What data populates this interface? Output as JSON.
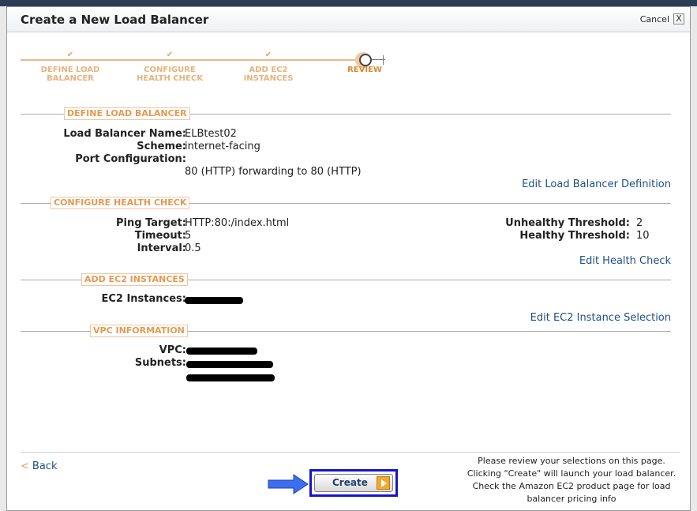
{
  "dialog": {
    "title": "Create a New Load Balancer",
    "cancel_label": "Cancel",
    "close_glyph": "X"
  },
  "wizard": {
    "check_glyph": "✔",
    "steps": [
      {
        "line1": "DEFINE LOAD",
        "line2": "BALANCER",
        "state": "done"
      },
      {
        "line1": "CONFIGURE",
        "line2": "HEALTH CHECK",
        "state": "done"
      },
      {
        "line1": "ADD EC2",
        "line2": "INSTANCES",
        "state": "done"
      },
      {
        "line1": "REVIEW",
        "line2": "",
        "state": "current"
      }
    ]
  },
  "define": {
    "tag": "DEFINE LOAD BALANCER",
    "name_label": "Load Balancer Name:",
    "name_value": "ELBtest02",
    "scheme_label": "Scheme:",
    "scheme_value": "internet-facing",
    "port_label": "Port Configuration:",
    "port_value": "80 (HTTP) forwarding to 80 (HTTP)",
    "edit_label": "Edit Load Balancer Definition"
  },
  "health": {
    "tag": "CONFIGURE HEALTH CHECK",
    "ping_label": "Ping Target:",
    "ping_value": "HTTP:80:/index.html",
    "timeout_label": "Timeout:",
    "timeout_value": "5",
    "interval_label": "Interval:",
    "interval_value": "0.5",
    "unhealthy_label": "Unhealthy Threshold:",
    "unhealthy_value": "2",
    "healthy_label": "Healthy Threshold:",
    "healthy_value": "10",
    "edit_label": "Edit Health Check"
  },
  "instances": {
    "tag": "ADD EC2 INSTANCES",
    "label": "EC2 Instances:",
    "edit_label": "Edit EC2 Instance Selection"
  },
  "vpc": {
    "tag": "VPC INFORMATION",
    "vpc_label": "VPC:",
    "subnets_label": "Subnets:"
  },
  "footer": {
    "back_glyph": "<",
    "back_label": "Back",
    "create_label": "Create",
    "note_line1": "Please review your selections on this page.",
    "note_line2": "Clicking \"Create\" will launch your load balancer.",
    "note_line3": "Check the Amazon EC2 product page for load",
    "note_line4": "balancer pricing info"
  },
  "colors": {
    "accent_orange": "#e39a52",
    "link_blue": "#1f4f85",
    "highlight_frame": "#1515c8",
    "pointer_arrow": "#3b6ff0"
  }
}
